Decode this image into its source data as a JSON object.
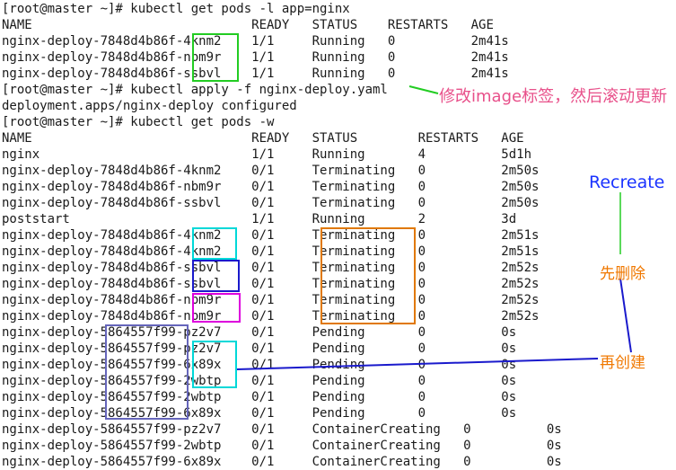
{
  "terminal": {
    "lines": [
      "[root@master ~]# kubectl get pods -l app=nginx",
      "NAME                             READY   STATUS    RESTARTS   AGE",
      "nginx-deploy-7848d4b86f-4knm2    1/1     Running   0          2m41s",
      "nginx-deploy-7848d4b86f-nbm9r    1/1     Running   0          2m41s",
      "nginx-deploy-7848d4b86f-ssbvl    1/1     Running   0          2m41s",
      "[root@master ~]# kubectl apply -f nginx-deploy.yaml",
      "deployment.apps/nginx-deploy configured",
      "[root@master ~]# kubectl get pods -w",
      "NAME                             READY   STATUS        RESTARTS   AGE",
      "nginx                            1/1     Running       4          5d1h",
      "nginx-deploy-7848d4b86f-4knm2    0/1     Terminating   0          2m50s",
      "nginx-deploy-7848d4b86f-nbm9r    0/1     Terminating   0          2m50s",
      "nginx-deploy-7848d4b86f-ssbvl    0/1     Terminating   0          2m50s",
      "poststart                        1/1     Running       2          3d",
      "nginx-deploy-7848d4b86f-4knm2    0/1     Terminating   0          2m51s",
      "nginx-deploy-7848d4b86f-4knm2    0/1     Terminating   0          2m51s",
      "nginx-deploy-7848d4b86f-ssbvl    0/1     Terminating   0          2m52s",
      "nginx-deploy-7848d4b86f-ssbvl    0/1     Terminating   0          2m52s",
      "nginx-deploy-7848d4b86f-nbm9r    0/1     Terminating   0          2m52s",
      "nginx-deploy-7848d4b86f-nbm9r    0/1     Terminating   0          2m52s",
      "nginx-deploy-5864557f99-pz2v7    0/1     Pending       0          0s",
      "nginx-deploy-5864557f99-pz2v7    0/1     Pending       0          0s",
      "nginx-deploy-5864557f99-6x89x    0/1     Pending       0          0s",
      "nginx-deploy-5864557f99-2wbtp    0/1     Pending       0          0s",
      "nginx-deploy-5864557f99-2wbtp    0/1     Pending       0          0s",
      "nginx-deploy-5864557f99-6x89x    0/1     Pending       0          0s",
      "nginx-deploy-5864557f99-pz2v7    0/1     ContainerCreating   0          0s",
      "nginx-deploy-5864557f99-2wbtp    0/1     ContainerCreating   0          0s",
      "nginx-deploy-5864557f99-6x89x    0/1     ContainerCreating   0          0s"
    ]
  },
  "annotations": {
    "update_note": "修改image标签，然后滚动更新",
    "recreate_label": "Recreate",
    "delete_first": "先删除",
    "create_after": "再创建"
  },
  "colors": {
    "green": "#22cc22",
    "cyan": "#00d8d8",
    "navy": "#1a1acc",
    "magenta": "#dd00dd",
    "orange": "#e07800",
    "slate": "#6666bb",
    "pink": "#e8508a",
    "blue": "#1a33ff",
    "amber": "#f07800",
    "line_blue": "#1a1acc"
  }
}
